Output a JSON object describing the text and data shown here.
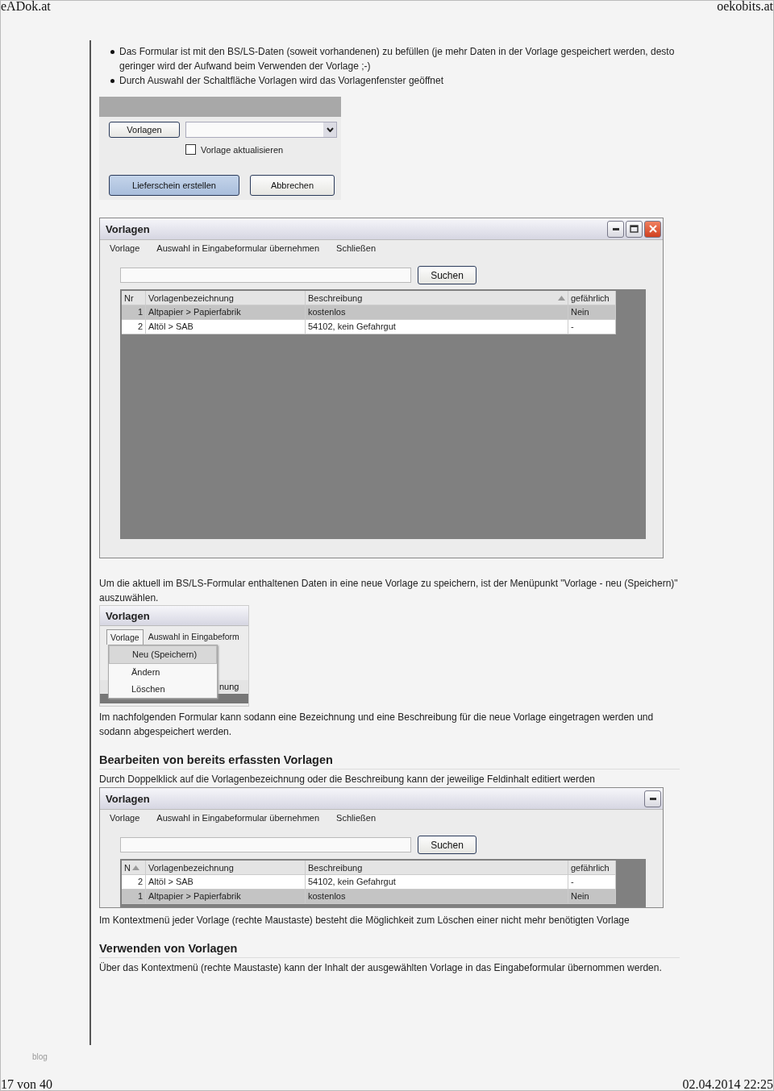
{
  "header": {
    "site": "eADok.at",
    "domain": "oekobits.at"
  },
  "blocks": [
    {
      "kind": "bullets",
      "items": [
        "Das Formular ist mit den BS/LS-Daten (soweit vorhandenen) zu befüllen (je mehr Daten in der Vorlage gespeichert werden, desto geringer wird der Aufwand beim Verwenden der Vorlage ;-)",
        "Durch Auswahl der Schaltfläche Vorlagen wird das Vorlagenfenster geöffnet"
      ]
    },
    {
      "kind": "form",
      "templates_button": "Vorlagen",
      "checkbox": {
        "label": "Vorlage aktualisieren",
        "checked": false
      },
      "buttons": [
        {
          "label": "Lieferschein erstellen",
          "highlighted": true
        },
        {
          "label": "Abbrechen",
          "highlighted": false
        }
      ]
    },
    {
      "kind": "window",
      "title": "Vorlagen",
      "controls": [
        {
          "kind": "minimize"
        },
        {
          "kind": "maximize"
        },
        {
          "kind": "close"
        }
      ],
      "menu": [
        "Vorlage",
        "Auswahl in Eingabeformular übernehmen",
        "Schließen"
      ],
      "search_button": "Suchen",
      "columns": [
        {
          "label": "Nr",
          "sorted": false
        },
        {
          "label": "Vorlagenbezeichnung",
          "sorted": false
        },
        {
          "label": "Beschreibung",
          "sorted": true
        },
        {
          "label": "gefährlich",
          "sorted": false
        }
      ],
      "rows": [
        {
          "cells": [
            "1",
            "Altpapier > Papierfabrik",
            "kostenlos",
            "Nein"
          ],
          "selected": true
        },
        {
          "cells": [
            "2",
            "Altöl > SAB",
            "54102, kein Gefahrgut",
            "-"
          ],
          "selected": false
        }
      ]
    },
    {
      "kind": "paragraph",
      "text": "Um die aktuell im BS/LS-Formular enthaltenen Daten in eine neue Vorlage zu speichern, ist der Menüpunkt \"Vorlage - neu (Speichern)\" auszuwählen."
    },
    {
      "kind": "menu_preview",
      "title": "Vorlagen",
      "menu": [
        {
          "label": "Vorlage",
          "selected": true
        },
        {
          "label": "Auswahl in Eingabeform",
          "selected": false
        }
      ],
      "items": [
        {
          "label": "Neu (Speichern)",
          "selected": true
        },
        {
          "label": "Ändern",
          "selected": false
        },
        {
          "label": "Löschen",
          "selected": false
        }
      ],
      "column_fragment": "nung"
    },
    {
      "kind": "paragraph",
      "text": "Im nachfolgenden Formular kann sodann eine Bezeichnung und eine Beschreibung für die neue Vorlage eingetragen werden und sodann abgespeichert werden."
    },
    {
      "kind": "heading",
      "text": "Bearbeiten von bereits erfassten Vorlagen"
    },
    {
      "kind": "paragraph",
      "text": "Durch Doppelklick auf die Vorlagenbezeichnung oder die Beschreibung kann der jeweilige Feldinhalt editiert werden"
    },
    {
      "kind": "window",
      "title": "Vorlagen",
      "controls": [
        {
          "kind": "minimize"
        }
      ],
      "menu": [
        "Vorlage",
        "Auswahl in Eingabeformular übernehmen",
        "Schließen"
      ],
      "search_button": "Suchen",
      "columns": [
        {
          "label": "N",
          "sorted": true
        },
        {
          "label": "Vorlagenbezeichnung",
          "sorted": false
        },
        {
          "label": "Beschreibung",
          "sorted": false
        },
        {
          "label": "gefährlich",
          "sorted": false
        }
      ],
      "rows": [
        {
          "cells": [
            "2",
            "Altöl > SAB",
            "54102, kein Gefahrgut",
            "-"
          ],
          "selected": false
        },
        {
          "cells": [
            "1",
            "Altpapier > Papierfabrik",
            "kostenlos",
            "Nein"
          ],
          "selected": true
        }
      ]
    },
    {
      "kind": "paragraph",
      "text": "Im Kontextmenü jeder Vorlage (rechte Maustaste) besteht die Möglichkeit zum Löschen einer nicht mehr benötigten Vorlage"
    },
    {
      "kind": "heading",
      "text": "Verwenden von Vorlagen"
    },
    {
      "kind": "paragraph",
      "text": "Über das Kontextmenü (rechte Maustaste) kann der Inhalt der ausgewählten Vorlage in das Eingabeformular übernommen werden."
    }
  ],
  "side_label": "blog",
  "footer": {
    "page": "17 von 40",
    "timestamp": "02.04.2014 22:25"
  }
}
